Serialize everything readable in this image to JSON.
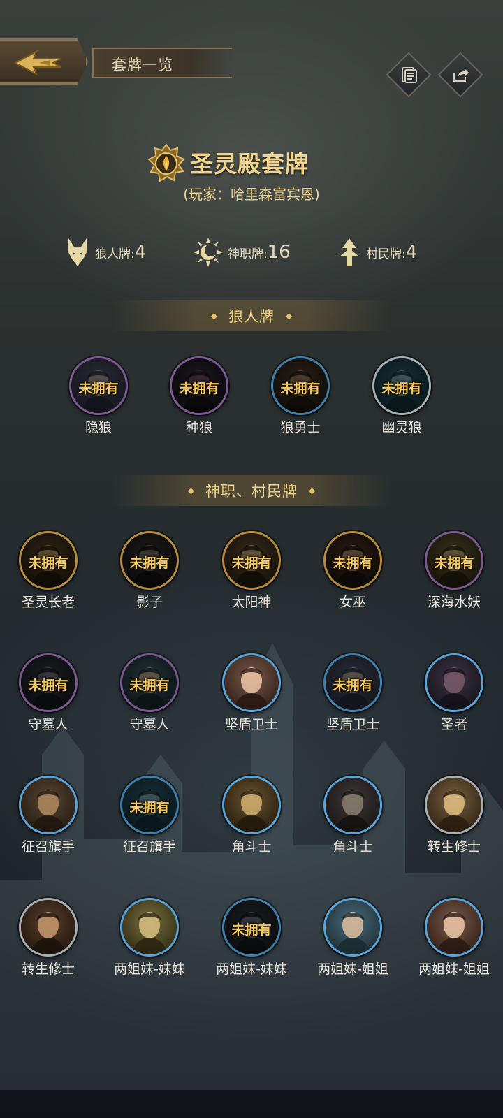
{
  "header": {
    "title": "套牌一览"
  },
  "deck": {
    "title": "圣灵殿套牌",
    "owner": "(玩家：哈里森富宾恩)"
  },
  "counts": [
    {
      "label": "狼人牌:",
      "value": "4",
      "icon": "wolf-icon"
    },
    {
      "label": "神职牌:",
      "value": "16",
      "icon": "sun-moon-icon"
    },
    {
      "label": "村民牌:",
      "value": "4",
      "icon": "villager-icon"
    }
  ],
  "sections": {
    "werewolf": "狼人牌",
    "god_villager": "神职、村民牌"
  },
  "badge_text": "未拥有",
  "werewolf_cards": [
    {
      "name": "隐狼",
      "owned": false
    },
    {
      "name": "种狼",
      "owned": false
    },
    {
      "name": "狼勇士",
      "owned": false
    },
    {
      "name": "幽灵狼",
      "owned": false
    }
  ],
  "god_cards": [
    {
      "name": "圣灵长老",
      "owned": false
    },
    {
      "name": "影子",
      "owned": false
    },
    {
      "name": "太阳神",
      "owned": false
    },
    {
      "name": "女巫",
      "owned": false
    },
    {
      "name": "深海水妖",
      "owned": false
    },
    {
      "name": "守墓人",
      "owned": false
    },
    {
      "name": "守墓人",
      "owned": false
    },
    {
      "name": "坚盾卫士",
      "owned": true
    },
    {
      "name": "坚盾卫士",
      "owned": false
    },
    {
      "name": "圣者",
      "owned": true
    },
    {
      "name": "征召旗手",
      "owned": true
    },
    {
      "name": "征召旗手",
      "owned": false
    },
    {
      "name": "角斗士",
      "owned": true
    },
    {
      "name": "角斗士",
      "owned": true
    },
    {
      "name": "转生修士",
      "owned": true
    },
    {
      "name": "转生修士",
      "owned": true
    },
    {
      "name": "两姐妹-妹妹",
      "owned": true
    },
    {
      "name": "两姐妹-妹妹",
      "owned": false
    },
    {
      "name": "两姐妹-姐姐",
      "owned": true
    },
    {
      "name": "两姐妹-姐姐",
      "owned": true
    }
  ]
}
